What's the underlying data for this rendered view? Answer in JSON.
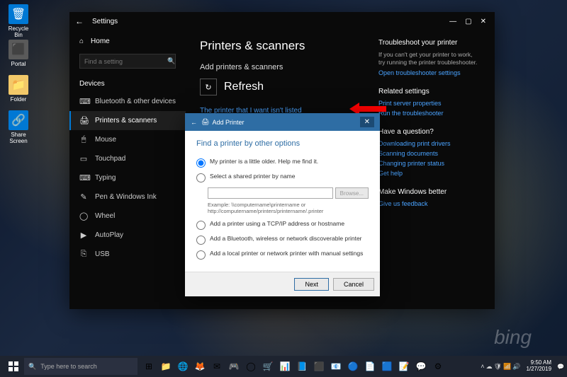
{
  "desktop": {
    "icons": [
      "Recycle Bin",
      "Portal",
      "Folder",
      "Share Screen"
    ],
    "watermark": "bing"
  },
  "taskbar": {
    "search_placeholder": "Type here to search",
    "time": "9:50 AM",
    "date": "1/27/2019"
  },
  "settings": {
    "title": "Settings",
    "home": "Home",
    "search_placeholder": "Find a setting",
    "section": "Devices",
    "items": [
      {
        "icon": "⌨",
        "label": "Bluetooth & other devices"
      },
      {
        "icon": "🖨",
        "label": "Printers & scanners"
      },
      {
        "icon": "🖱",
        "label": "Mouse"
      },
      {
        "icon": "▭",
        "label": "Touchpad"
      },
      {
        "icon": "⌨",
        "label": "Typing"
      },
      {
        "icon": "✎",
        "label": "Pen & Windows Ink"
      },
      {
        "icon": "◯",
        "label": "Wheel"
      },
      {
        "icon": "▶",
        "label": "AutoPlay"
      },
      {
        "icon": "⎘",
        "label": "USB"
      }
    ],
    "main": {
      "heading": "Printers & scanners",
      "add_section": "Add printers & scanners",
      "refresh": "Refresh",
      "not_listed": "The printer that I want isn't listed"
    },
    "right": {
      "troubleshoot_h": "Troubleshoot your printer",
      "troubleshoot_p": "If you can't get your printer to work, try running the printer troubleshooter.",
      "troubleshoot_link": "Open troubleshooter settings",
      "related_h": "Related settings",
      "related_links": [
        "Print server properties",
        "Run the troubleshooter"
      ],
      "question_h": "Have a question?",
      "question_links": [
        "Downloading print drivers",
        "Scanning documents",
        "Changing printer status",
        "Get help"
      ],
      "better_h": "Make Windows better",
      "better_link": "Give us feedback"
    }
  },
  "dialog": {
    "title": "Add Printer",
    "heading": "Find a printer by other options",
    "options": [
      "My printer is a little older. Help me find it.",
      "Select a shared printer by name",
      "Add a printer using a TCP/IP address or hostname",
      "Add a Bluetooth, wireless or network discoverable printer",
      "Add a local printer or network printer with manual settings"
    ],
    "browse": "Browse...",
    "example": "Example: \\\\computername\\printername or http://computername/printers/printername/.printer",
    "next": "Next",
    "cancel": "Cancel"
  }
}
